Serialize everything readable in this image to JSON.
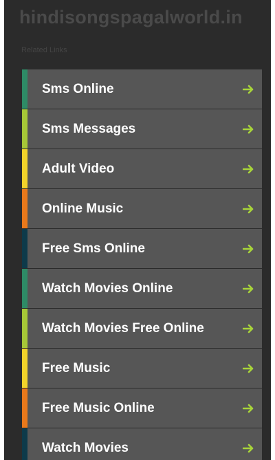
{
  "header": {
    "site_title": "hindisongspagalworld.in"
  },
  "related": {
    "label": "Related Links",
    "items": [
      {
        "label": "Sms Online",
        "color": "#2e8b66"
      },
      {
        "label": "Sms Messages",
        "color": "#a6c837"
      },
      {
        "label": "Adult Video",
        "color": "#f2d32a"
      },
      {
        "label": "Online Music",
        "color": "#e9791b"
      },
      {
        "label": "Free Sms Online",
        "color": "#0d3a4a"
      },
      {
        "label": "Watch Movies Online",
        "color": "#2e8b66"
      },
      {
        "label": "Watch Movies Free Online",
        "color": "#a6c837"
      },
      {
        "label": "Free Music",
        "color": "#f2d32a"
      },
      {
        "label": "Free Music Online",
        "color": "#e9791b"
      },
      {
        "label": "Watch Movies",
        "color": "#0d3a4a"
      }
    ]
  },
  "icons": {
    "item_arrow": "arrow-right-icon",
    "arrow_color": "#a8d43a"
  }
}
